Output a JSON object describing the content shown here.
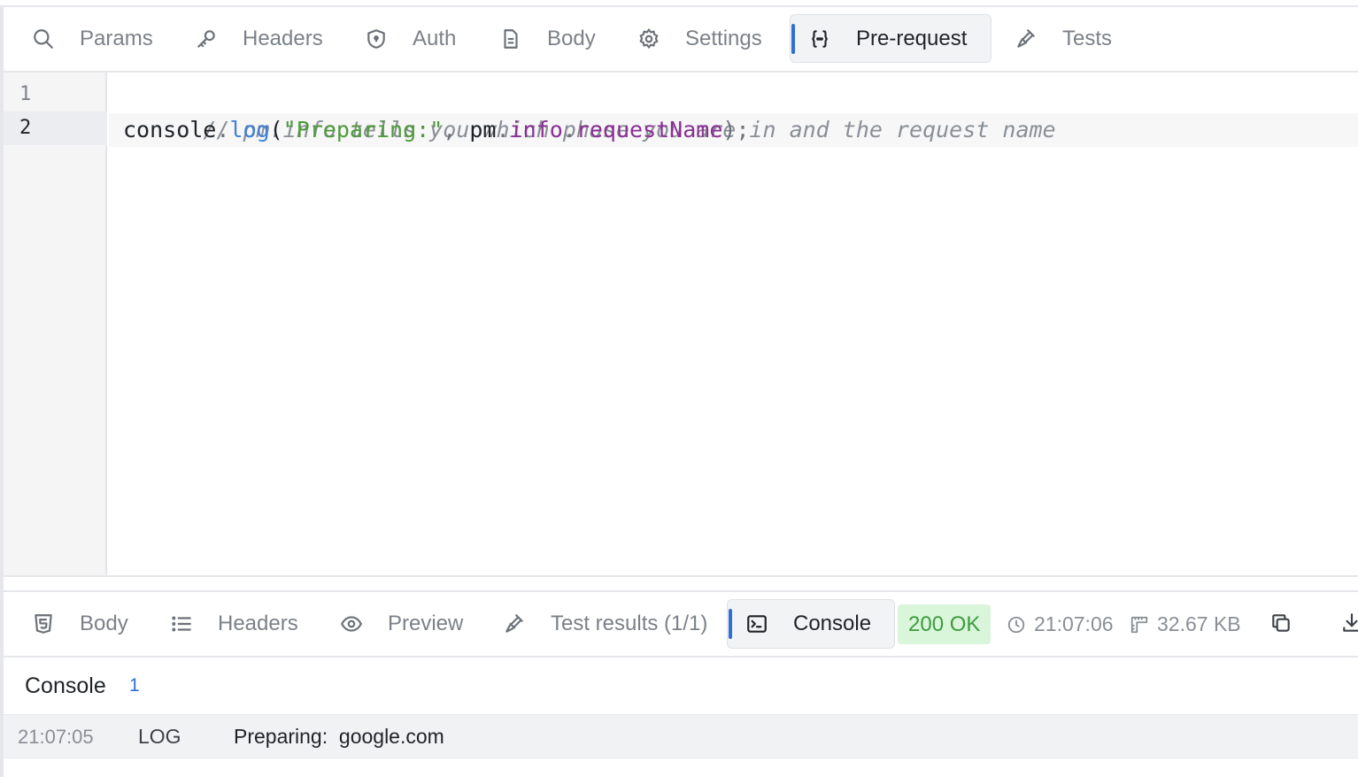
{
  "request_tabs": [
    {
      "label": "Params",
      "icon": "search-icon"
    },
    {
      "label": "Headers",
      "icon": "key-icon"
    },
    {
      "label": "Auth",
      "icon": "shield-icon"
    },
    {
      "label": "Body",
      "icon": "document-icon"
    },
    {
      "label": "Settings",
      "icon": "gear-icon"
    },
    {
      "label": "Pre-request",
      "icon": "braces-icon",
      "active": true
    },
    {
      "label": "Tests",
      "icon": "flask-icon"
    }
  ],
  "editor": {
    "line_numbers": [
      "1",
      "2"
    ],
    "active_line": 2,
    "lines": [
      {
        "comment": "// pm.info tells you which phase you are in and the request name"
      },
      {
        "obj": "console",
        "dot1": ".",
        "fn": "log",
        "open": "(",
        "str": "\"Preparing:\"",
        "comma": ", ",
        "pm": "pm",
        "dot2": ".",
        "info": "info",
        "dot3": ".",
        "prop": "requestName",
        "close": ");"
      }
    ]
  },
  "response_tabs": [
    {
      "label": "Body",
      "icon": "html5-icon"
    },
    {
      "label": "Headers",
      "icon": "list-icon"
    },
    {
      "label": "Preview",
      "icon": "eye-icon"
    },
    {
      "label": "Test results (1/1)",
      "icon": "flask-icon"
    },
    {
      "label": "Console",
      "icon": "terminal-icon",
      "active": true
    }
  ],
  "response_meta": {
    "status": "200 OK",
    "time": "21:07:06",
    "size": "32.67 KB",
    "status_color": "#3e9b3e",
    "status_bg": "#d9f5da"
  },
  "console": {
    "title": "Console",
    "count": "1",
    "entries": [
      {
        "time": "21:07:05",
        "level": "LOG",
        "message": "Preparing:  google.com"
      }
    ]
  },
  "colors": {
    "accent": "#2f6fd6"
  }
}
